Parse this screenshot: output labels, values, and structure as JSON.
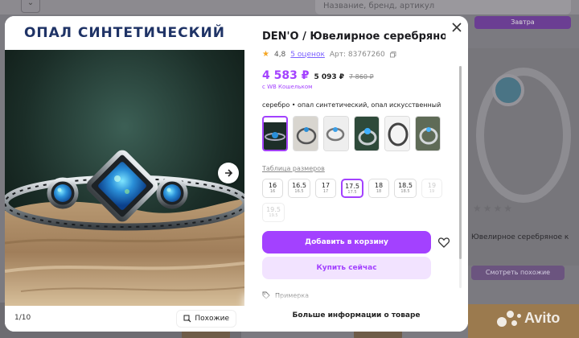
{
  "background": {
    "search_placeholder": "Название, бренд, артикул",
    "cart_label": "Завтра",
    "card_title": "Ювелирное серебряное к",
    "more_button": "Смотреть похожие",
    "watermark": "Avito"
  },
  "gallery": {
    "banner_text": "ОПАЛ СИНТЕТИЧЕСКИЙ",
    "counter": "1/10",
    "similar_label": "Похожие"
  },
  "product": {
    "title": "DEN'O / Ювелирное серебряное к",
    "rating": "4,8",
    "reviews": "5 оценок",
    "article": "Арт: 83767260",
    "price": "4 583 ₽",
    "price_wallet": "5 093 ₽",
    "price_old": "7 860 ₽",
    "wallet_note": "с WB Кошельком",
    "properties": "серебро • опал синтетический, опал искусственный",
    "size_table_link": "Таблица размеров",
    "sizes": [
      {
        "label": "16",
        "sub": "16",
        "state": "normal"
      },
      {
        "label": "16.5",
        "sub": "16.5",
        "state": "normal"
      },
      {
        "label": "17",
        "sub": "17",
        "state": "normal"
      },
      {
        "label": "17.5",
        "sub": "17.5",
        "state": "selected"
      },
      {
        "label": "18",
        "sub": "18",
        "state": "normal"
      },
      {
        "label": "18.5",
        "sub": "18.5",
        "state": "normal"
      },
      {
        "label": "19",
        "sub": "19",
        "state": "disabled"
      },
      {
        "label": "19.5",
        "sub": "19.5",
        "state": "disabled"
      }
    ],
    "add_to_cart": "Добавить в корзину",
    "buy_now": "Купить сейчас",
    "fitting": "Примерка",
    "more_info": "Больше информации о товаре"
  },
  "colors": {
    "accent": "#a341ff",
    "accent_light": "#f2e3ff",
    "overlay": "#7b7a80"
  }
}
